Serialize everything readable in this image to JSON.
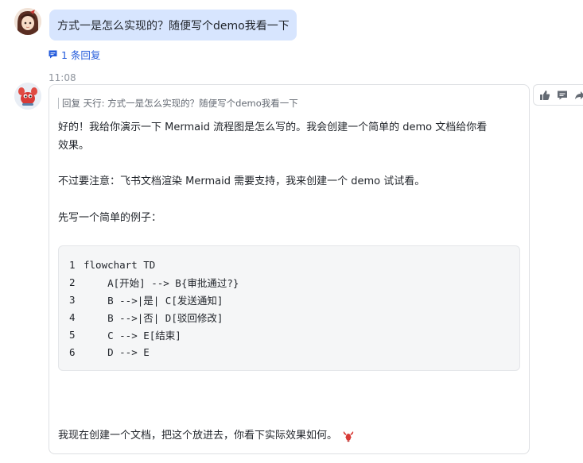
{
  "user_message": {
    "text": "方式一是怎么实现的？随便写个demo我看一下",
    "reply_count_label": "1 条回复"
  },
  "bot_message": {
    "timestamp": "11:08",
    "quote": "回复 天行: 方式一是怎么实现的？随便写个demo我看一下",
    "paragraph_1_line_1": "好的！我给你演示一下 Mermaid 流程图是怎么写的。我会创建一个简单的 demo 文档给你看",
    "paragraph_1_line_2": "效果。",
    "paragraph_2": "不过要注意：飞书文档渲染 Mermaid 需要支持，我来创建一个 demo 试试看。",
    "paragraph_3": "先写一个简单的例子：",
    "code_lines": [
      {
        "n": "1",
        "code": "flowchart TD"
      },
      {
        "n": "2",
        "code": "    A[开始] --> B{审批通过?}"
      },
      {
        "n": "3",
        "code": "    B -->|是| C[发送通知]"
      },
      {
        "n": "4",
        "code": "    B -->|否| D[驳回修改]"
      },
      {
        "n": "5",
        "code": "    C --> E[结束]"
      },
      {
        "n": "6",
        "code": "    D --> E"
      }
    ],
    "closing": "我现在创建一个文档，把这个放进去，你看下实际效果如何。",
    "closing_emoji": "lobster-icon"
  },
  "toolbar": {
    "icons": [
      "thumbs-up-icon",
      "comment-icon",
      "forward-icon"
    ]
  },
  "colors": {
    "user_bubble": "#d7e5fe",
    "link": "#245bdb",
    "code_bg": "#f5f6f7",
    "lobster": "#d83a36"
  }
}
